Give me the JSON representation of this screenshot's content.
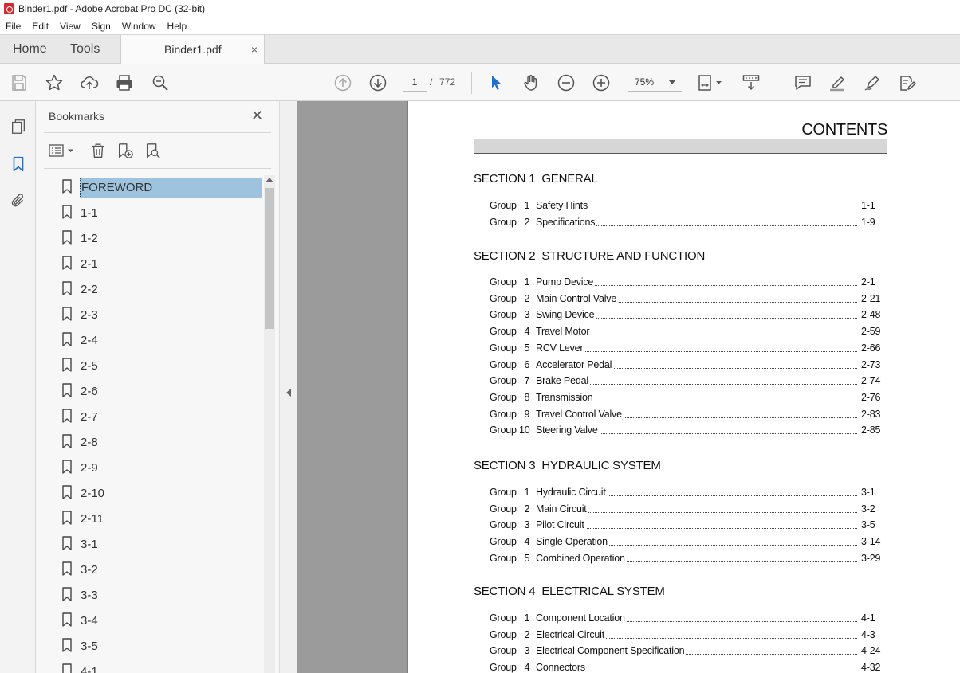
{
  "window": {
    "title": "Binder1.pdf - Adobe Acrobat Pro DC (32-bit)"
  },
  "menu": [
    "File",
    "Edit",
    "View",
    "Sign",
    "Window",
    "Help"
  ],
  "tabs": {
    "home": "Home",
    "tools": "Tools",
    "document": "Binder1.pdf",
    "close": "×"
  },
  "toolbar": {
    "page_current": "1",
    "page_separator": "/",
    "page_total": "772",
    "zoom": "75%"
  },
  "bookmarks": {
    "title": "Bookmarks",
    "close": "✕",
    "items": [
      {
        "label": "FOREWORD",
        "selected": true
      },
      {
        "label": "1-1"
      },
      {
        "label": "1-2"
      },
      {
        "label": "2-1"
      },
      {
        "label": "2-2"
      },
      {
        "label": "2-3"
      },
      {
        "label": "2-4"
      },
      {
        "label": "2-5"
      },
      {
        "label": "2-6"
      },
      {
        "label": "2-7"
      },
      {
        "label": "2-8"
      },
      {
        "label": "2-9"
      },
      {
        "label": "2-10"
      },
      {
        "label": "2-11"
      },
      {
        "label": "3-1"
      },
      {
        "label": "3-2"
      },
      {
        "label": "3-3"
      },
      {
        "label": "3-4"
      },
      {
        "label": "3-5"
      },
      {
        "label": "4-1"
      }
    ]
  },
  "document": {
    "title": "CONTENTS",
    "sections": [
      {
        "heading": "SECTION 1  GENERAL",
        "entries": [
          {
            "group": "Group   1",
            "title": "Safety Hints",
            "page": "1-1"
          },
          {
            "group": "Group   2",
            "title": "Specifications",
            "page": "1-9"
          }
        ]
      },
      {
        "heading": "SECTION 2  STRUCTURE AND FUNCTION",
        "entries": [
          {
            "group": "Group   1",
            "title": "Pump Device",
            "page": "2-1"
          },
          {
            "group": "Group   2",
            "title": "Main Control Valve",
            "page": "2-21"
          },
          {
            "group": "Group   3",
            "title": "Swing Device",
            "page": "2-48"
          },
          {
            "group": "Group   4",
            "title": "Travel Motor",
            "page": "2-59"
          },
          {
            "group": "Group   5",
            "title": "RCV Lever",
            "page": "2-66"
          },
          {
            "group": "Group   6",
            "title": "Accelerator Pedal",
            "page": "2-73"
          },
          {
            "group": "Group   7",
            "title": "Brake Pedal",
            "page": "2-74"
          },
          {
            "group": "Group   8",
            "title": "Transmission",
            "page": "2-76"
          },
          {
            "group": "Group   9",
            "title": "Travel Control Valve",
            "page": "2-83"
          },
          {
            "group": "Group 10",
            "title": "Steering Valve",
            "page": "2-85"
          }
        ]
      },
      {
        "heading": "SECTION 3  HYDRAULIC SYSTEM",
        "entries": [
          {
            "group": "Group   1",
            "title": "Hydraulic Circuit",
            "page": "3-1"
          },
          {
            "group": "Group   2",
            "title": "Main Circuit",
            "page": "3-2"
          },
          {
            "group": "Group   3",
            "title": "Pilot Circuit",
            "page": "3-5"
          },
          {
            "group": "Group   4",
            "title": "Single Operation",
            "page": "3-14"
          },
          {
            "group": "Group   5",
            "title": "Combined Operation",
            "page": "3-29"
          }
        ]
      },
      {
        "heading": "SECTION 4  ELECTRICAL SYSTEM",
        "entries": [
          {
            "group": "Group   1",
            "title": "Component Location",
            "page": "4-1"
          },
          {
            "group": "Group   2",
            "title": "Electrical Circuit",
            "page": "4-3"
          },
          {
            "group": "Group   3",
            "title": "Electrical Component Specification",
            "page": "4-24"
          },
          {
            "group": "Group   4",
            "title": "Connectors",
            "page": "4-32"
          }
        ]
      }
    ]
  }
}
